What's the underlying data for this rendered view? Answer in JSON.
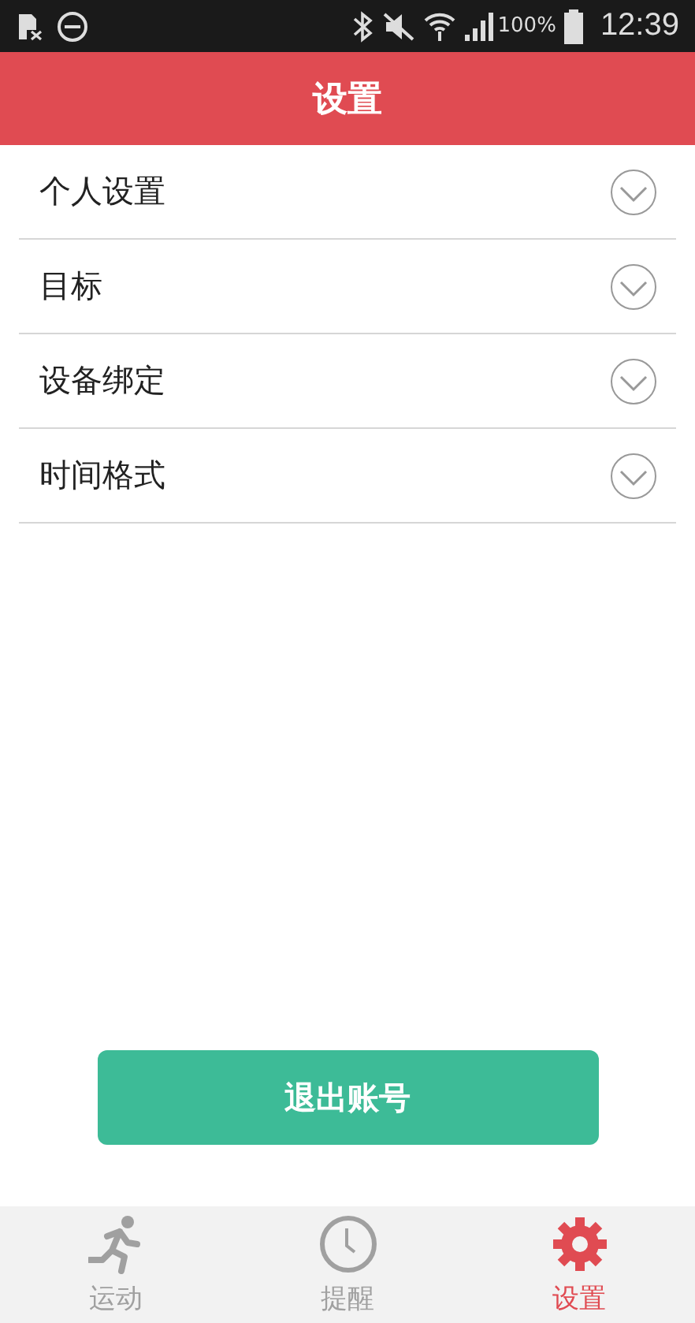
{
  "status_bar": {
    "battery": "100%",
    "time": "12:39"
  },
  "header": {
    "title": "设置"
  },
  "settings": [
    {
      "label": "个人设置",
      "expanded": false
    },
    {
      "label": "目标",
      "expanded": false
    },
    {
      "label": "设备绑定",
      "expanded": false
    },
    {
      "label": "时间格式",
      "expanded": false
    }
  ],
  "logout_button": "退出账号",
  "tabs": [
    {
      "label": "运动",
      "kind": "run",
      "selected": false
    },
    {
      "label": "提醒",
      "kind": "clock",
      "selected": false
    },
    {
      "label": "设置",
      "kind": "gear",
      "selected": true
    }
  ]
}
